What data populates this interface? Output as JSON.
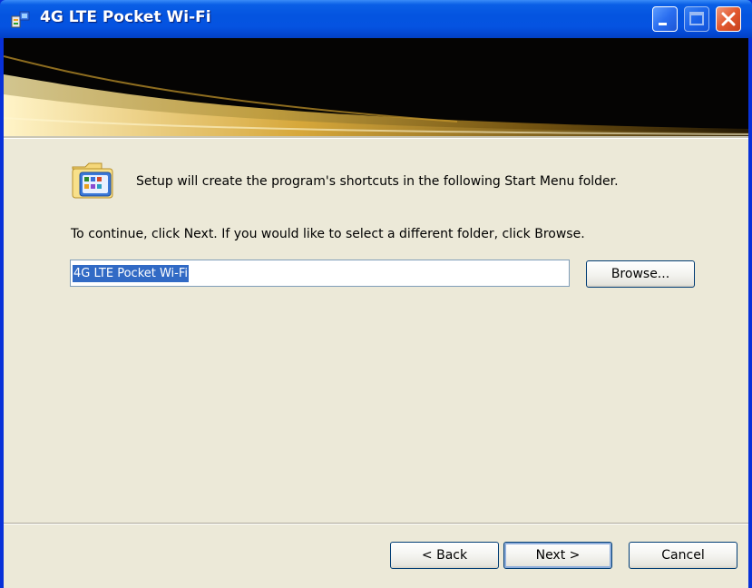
{
  "window": {
    "title": "4G LTE Pocket Wi-Fi",
    "controls": {
      "minimize": "minimize-icon",
      "maximize": "maximize-icon",
      "close": "close-icon"
    }
  },
  "banner": {
    "icon": "gold-swoosh-banner"
  },
  "content": {
    "message": "Setup will create the program's shortcuts in the following Start Menu folder.",
    "instruction": "To continue, click Next. If you would like to select a different folder, click Browse.",
    "folder_value": "4G LTE Pocket Wi-Fi",
    "browse_label": "Browse..."
  },
  "footer": {
    "back_label": "< Back",
    "next_label": "Next >",
    "cancel_label": "Cancel"
  },
  "colors": {
    "titlebar": "#0454e0",
    "dialog_bg": "#ece9d8",
    "selection": "#316ac5",
    "close_button": "#e2582e"
  }
}
